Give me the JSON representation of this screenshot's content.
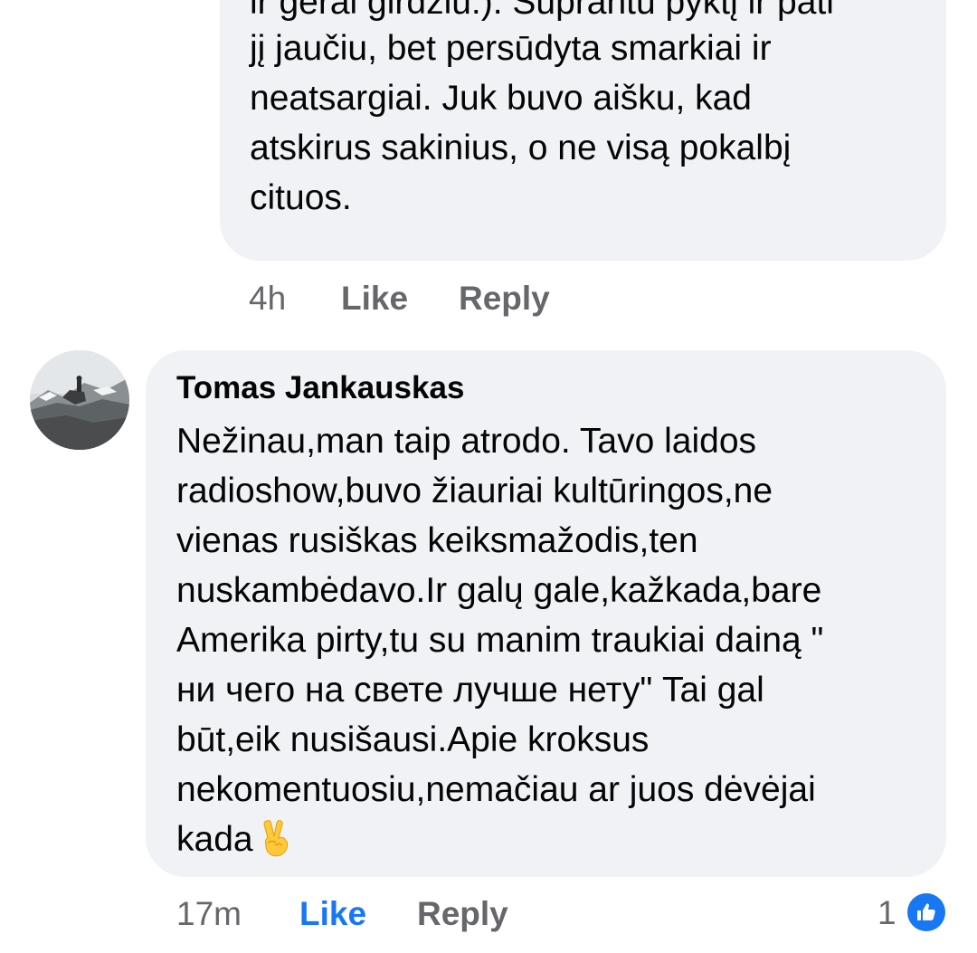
{
  "previous_comment": {
    "cut_off_line": "ir gerai girdžiu:). Suprantu pyktį ir pati",
    "text": "jį jaučiu, bet persūdyta smarkiai ir\nneatsargiai. Juk buvo aišku, kad\natskirus sakinius, o ne visą pokalbį\ncituos.",
    "timestamp": "4h",
    "like_label": "Like",
    "reply_label": "Reply"
  },
  "comment": {
    "author": "Tomas Jankauskas",
    "text": "Nežinau,man taip atrodo. Tavo laidos\nradioshow,buvo žiauriai kultūringos,ne\nvienas rusiškas keiksmažodis,ten\nnuskambėdavo.Ir galų gale,kažkada,bare\nAmerika pirty,tu su manim traukiai dainą \"\nни чего на свете лучше нету\" Tai gal\nbūt,eik nusišausi.Apie kroksus\nnekomentuosiu,nemačiau ar juos dėvėjai\nkada",
    "emoji": "victory-hand",
    "timestamp": "17m",
    "like_label": "Like",
    "reply_label": "Reply",
    "reaction_count": "1",
    "reaction_type": "like"
  },
  "colors": {
    "bubble": "#f0f2f5",
    "text": "#050505",
    "secondary": "#65676b",
    "accent": "#1877f2"
  }
}
